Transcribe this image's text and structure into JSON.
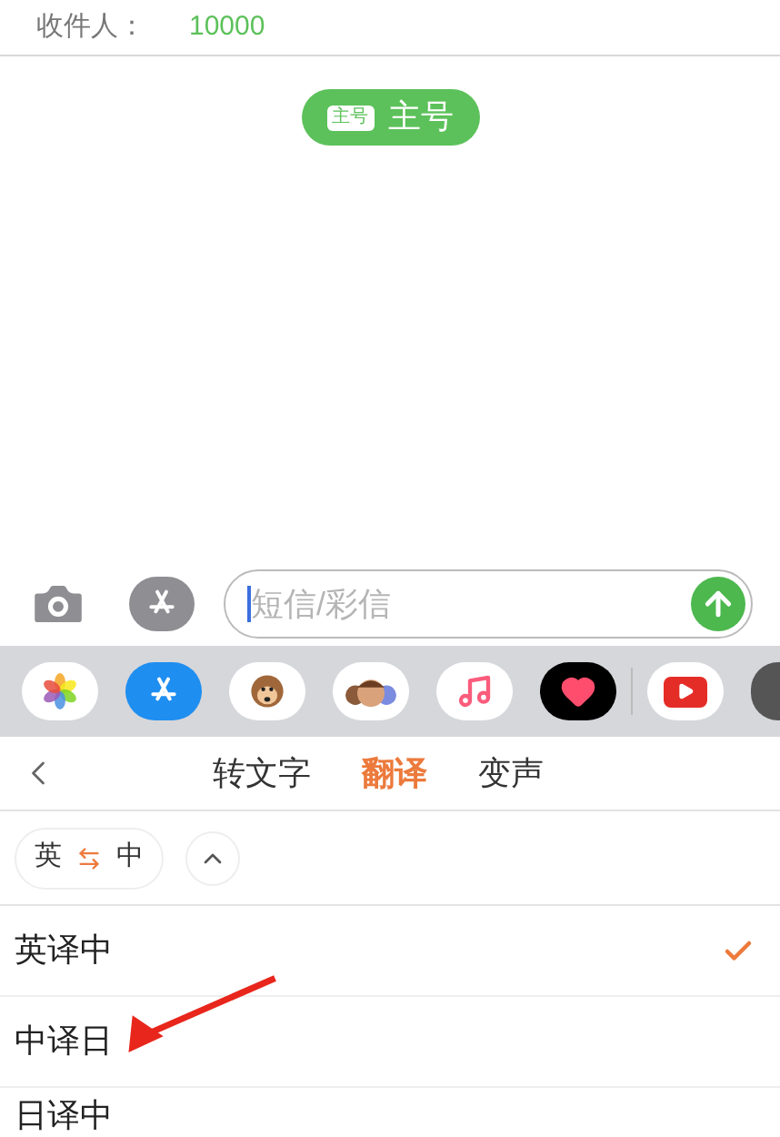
{
  "recipient": {
    "label": "收件人：",
    "value": "10000"
  },
  "sim_badge": {
    "tag": "主号",
    "label": "主号"
  },
  "compose": {
    "placeholder": "短信/彩信"
  },
  "tabs": [
    {
      "label": "转文字",
      "selected": false
    },
    {
      "label": "翻译",
      "selected": true
    },
    {
      "label": "变声",
      "selected": false
    }
  ],
  "language_pair": {
    "source": "英",
    "target": "中",
    "expanded": true
  },
  "options": [
    {
      "label": "英译中",
      "selected": true
    },
    {
      "label": "中译日",
      "selected": false
    },
    {
      "label": "日译中",
      "selected": false
    }
  ]
}
